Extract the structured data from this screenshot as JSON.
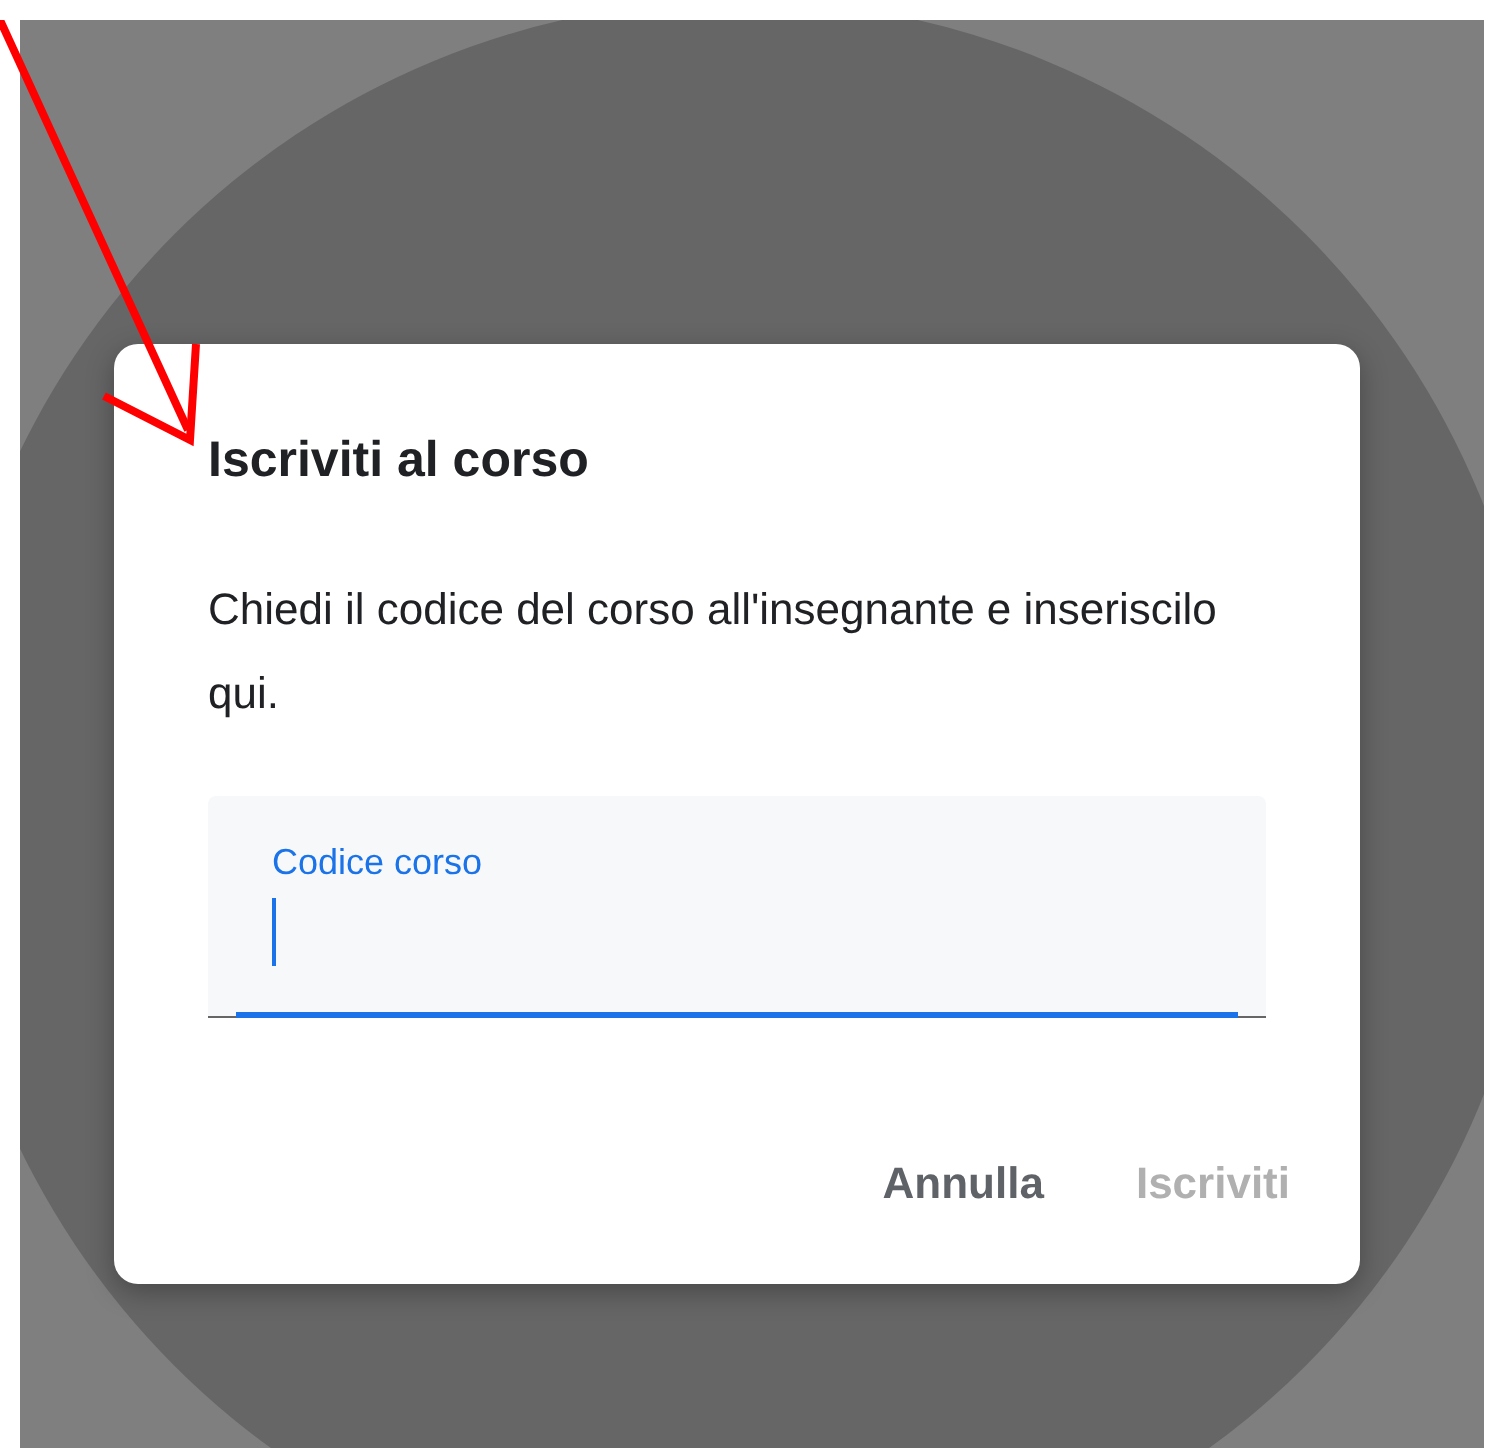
{
  "dialog": {
    "title": "Iscriviti al corso",
    "message": "Chiedi il codice del corso all'insegnante e inseriscilo qui.",
    "field": {
      "label": "Codice corso",
      "focused": true
    },
    "buttons": [
      {
        "label": "Annulla",
        "disabled": false
      },
      {
        "label": "Iscriviti",
        "disabled": true
      }
    ]
  }
}
